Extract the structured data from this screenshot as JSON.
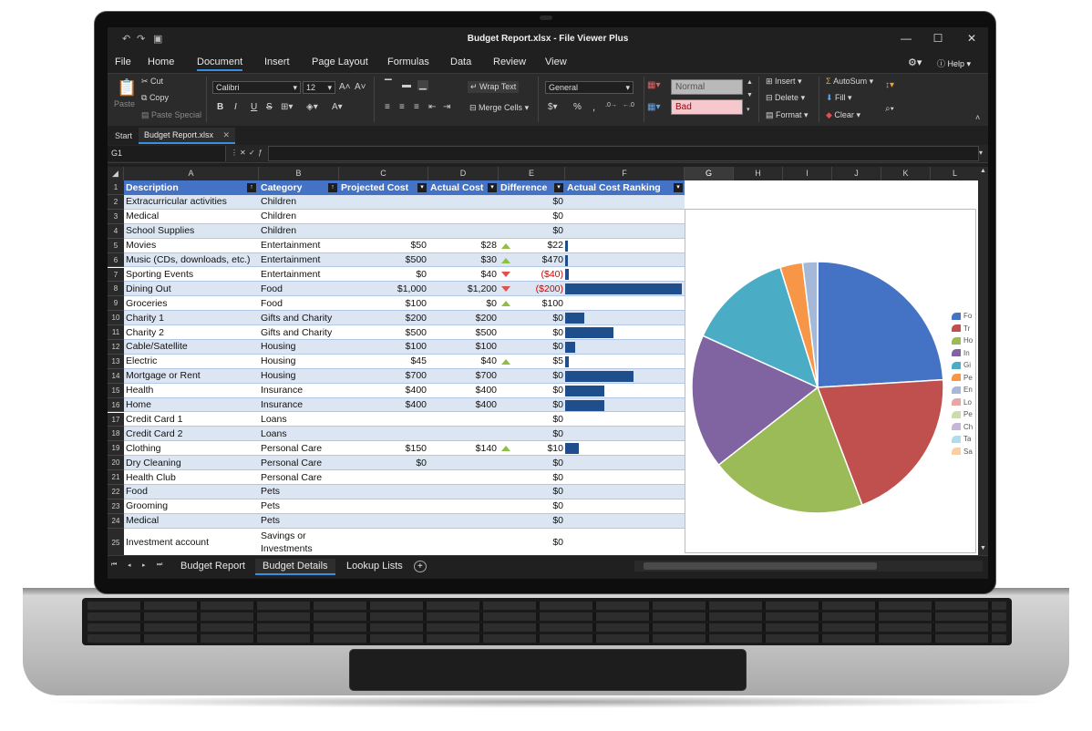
{
  "window": {
    "title": "Budget Report.xlsx - File Viewer Plus",
    "help_label": "Help",
    "minimize": "—",
    "maximize": "☐",
    "close": "✕"
  },
  "menu": [
    "File",
    "Home",
    "Document",
    "Insert",
    "Page Layout",
    "Formulas",
    "Data",
    "Review",
    "View"
  ],
  "menu_active": "Document",
  "ribbon": {
    "paste": "Paste",
    "cut": "Cut",
    "copy": "Copy",
    "paste_special": "Paste Special",
    "font_name": "Calibri",
    "font_size": "12",
    "bold": "B",
    "italic": "I",
    "underline": "U",
    "strike": "S",
    "wrap_text": "Wrap Text",
    "merge_cells": "Merge Cells",
    "number_format": "General",
    "percent": "%",
    "comma": ",",
    "style_normal": "Normal",
    "style_bad": "Bad",
    "insert": "Insert",
    "delete": "Delete",
    "format": "Format",
    "autosum": "AutoSum",
    "fill": "Fill",
    "clear": "Clear"
  },
  "tabs": {
    "start": "Start",
    "doc": "Budget Report.xlsx"
  },
  "formula": {
    "cell_ref": "G1",
    "fx_value": ""
  },
  "columns": [
    "A",
    "B",
    "C",
    "D",
    "E",
    "F",
    "G",
    "H",
    "I",
    "J",
    "K",
    "L"
  ],
  "headers": [
    "Description",
    "Category",
    "Projected Cost",
    "Actual Cost",
    "Difference",
    "Actual Cost Ranking"
  ],
  "rows": [
    {
      "n": "2",
      "desc": "Extracurricular activities",
      "cat": "Children",
      "proj": "",
      "act": "",
      "ind": "",
      "diff": "$0",
      "neg": false,
      "rank": 0
    },
    {
      "n": "3",
      "desc": "Medical",
      "cat": "Children",
      "proj": "",
      "act": "",
      "ind": "",
      "diff": "$0",
      "neg": false,
      "rank": 0
    },
    {
      "n": "4",
      "desc": "School Supplies",
      "cat": "Children",
      "proj": "",
      "act": "",
      "ind": "",
      "diff": "$0",
      "neg": false,
      "rank": 0
    },
    {
      "n": "5",
      "desc": "Movies",
      "cat": "Entertainment",
      "proj": "$50",
      "act": "$28",
      "ind": "up",
      "diff": "$22",
      "neg": false,
      "rank": 28
    },
    {
      "n": "6",
      "desc": "Music (CDs, downloads, etc.)",
      "cat": "Entertainment",
      "proj": "$500",
      "act": "$30",
      "ind": "up",
      "diff": "$470",
      "neg": false,
      "rank": 30
    },
    {
      "n": "7",
      "desc": "Sporting Events",
      "cat": "Entertainment",
      "proj": "$0",
      "act": "$40",
      "ind": "down",
      "diff": "($40)",
      "neg": true,
      "rank": 40
    },
    {
      "n": "8",
      "desc": "Dining Out",
      "cat": "Food",
      "proj": "$1,000",
      "act": "$1,200",
      "ind": "down",
      "diff": "($200)",
      "neg": true,
      "rank": 1200
    },
    {
      "n": "9",
      "desc": "Groceries",
      "cat": "Food",
      "proj": "$100",
      "act": "$0",
      "ind": "up",
      "diff": "$100",
      "neg": false,
      "rank": 0
    },
    {
      "n": "10",
      "desc": "Charity 1",
      "cat": "Gifts and Charity",
      "proj": "$200",
      "act": "$200",
      "ind": "",
      "diff": "$0",
      "neg": false,
      "rank": 200
    },
    {
      "n": "11",
      "desc": "Charity 2",
      "cat": "Gifts and Charity",
      "proj": "$500",
      "act": "$500",
      "ind": "",
      "diff": "$0",
      "neg": false,
      "rank": 500
    },
    {
      "n": "12",
      "desc": "Cable/Satellite",
      "cat": "Housing",
      "proj": "$100",
      "act": "$100",
      "ind": "",
      "diff": "$0",
      "neg": false,
      "rank": 100
    },
    {
      "n": "13",
      "desc": "Electric",
      "cat": "Housing",
      "proj": "$45",
      "act": "$40",
      "ind": "up",
      "diff": "$5",
      "neg": false,
      "rank": 40
    },
    {
      "n": "14",
      "desc": "Mortgage or Rent",
      "cat": "Housing",
      "proj": "$700",
      "act": "$700",
      "ind": "",
      "diff": "$0",
      "neg": false,
      "rank": 700
    },
    {
      "n": "15",
      "desc": "Health",
      "cat": "Insurance",
      "proj": "$400",
      "act": "$400",
      "ind": "",
      "diff": "$0",
      "neg": false,
      "rank": 400
    },
    {
      "n": "16",
      "desc": "Home",
      "cat": "Insurance",
      "proj": "$400",
      "act": "$400",
      "ind": "",
      "diff": "$0",
      "neg": false,
      "rank": 400
    },
    {
      "n": "17",
      "desc": "Credit Card 1",
      "cat": "Loans",
      "proj": "",
      "act": "",
      "ind": "",
      "diff": "$0",
      "neg": false,
      "rank": 0
    },
    {
      "n": "18",
      "desc": "Credit Card 2",
      "cat": "Loans",
      "proj": "",
      "act": "",
      "ind": "",
      "diff": "$0",
      "neg": false,
      "rank": 0
    },
    {
      "n": "19",
      "desc": "Clothing",
      "cat": "Personal Care",
      "proj": "$150",
      "act": "$140",
      "ind": "up",
      "diff": "$10",
      "neg": false,
      "rank": 140
    },
    {
      "n": "20",
      "desc": "Dry Cleaning",
      "cat": "Personal Care",
      "proj": "$0",
      "act": "",
      "ind": "",
      "diff": "$0",
      "neg": false,
      "rank": 0
    },
    {
      "n": "21",
      "desc": "Health Club",
      "cat": "Personal Care",
      "proj": "",
      "act": "",
      "ind": "",
      "diff": "$0",
      "neg": false,
      "rank": 0
    },
    {
      "n": "22",
      "desc": "Food",
      "cat": "Pets",
      "proj": "",
      "act": "",
      "ind": "",
      "diff": "$0",
      "neg": false,
      "rank": 0
    },
    {
      "n": "23",
      "desc": "Grooming",
      "cat": "Pets",
      "proj": "",
      "act": "",
      "ind": "",
      "diff": "$0",
      "neg": false,
      "rank": 0
    },
    {
      "n": "24",
      "desc": "Medical",
      "cat": "Pets",
      "proj": "",
      "act": "",
      "ind": "",
      "diff": "$0",
      "neg": false,
      "rank": 0
    },
    {
      "n": "25",
      "desc": "Investment account",
      "cat": "Savings or Investments",
      "proj": "",
      "act": "",
      "ind": "",
      "diff": "$0",
      "neg": false,
      "rank": 0
    }
  ],
  "chart_data": {
    "type": "pie",
    "categories": [
      "Fo",
      "Tr",
      "Ho",
      "In",
      "Gi",
      "Pe",
      "En",
      "Lo",
      "Pe",
      "Ch",
      "Ta",
      "Sa"
    ],
    "values": [
      25,
      21,
      21,
      18,
      14,
      3,
      2,
      0,
      0,
      0,
      0,
      0
    ],
    "colors": [
      "#4472c4",
      "#c0504d",
      "#9bbb59",
      "#8064a2",
      "#4bacc6",
      "#f79646",
      "#a5b8d8",
      "#e6a7a6",
      "#cddcaf",
      "#c6b7d6",
      "#b0dceb",
      "#fbcfa6"
    ],
    "legend": "right"
  },
  "sheets": [
    "Budget Report",
    "Budget Details",
    "Lookup Lists"
  ],
  "sheet_active": "Budget Details",
  "sheet_add": "+"
}
